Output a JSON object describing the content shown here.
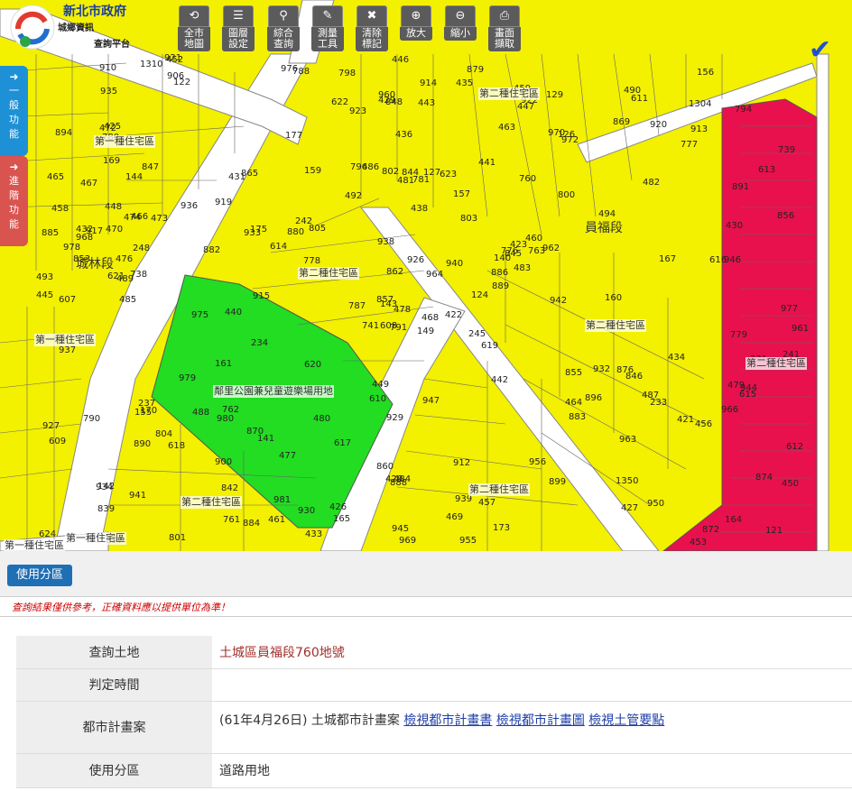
{
  "logo": {
    "line1": "新北市政府",
    "line2": "城鄉資訊",
    "line3": "查詢平台"
  },
  "toolbar": [
    {
      "icon": "refresh-icon",
      "glyph": "⟲",
      "label_l1": "全市",
      "label_l2": "地圖"
    },
    {
      "icon": "layers-icon",
      "glyph": "☰",
      "label_l1": "圖層",
      "label_l2": "設定"
    },
    {
      "icon": "search-icon",
      "glyph": "⚲",
      "label_l1": "綜合",
      "label_l2": "查詢"
    },
    {
      "icon": "ruler-icon",
      "glyph": "✎",
      "label_l1": "測量",
      "label_l2": "工具"
    },
    {
      "icon": "clear-icon",
      "glyph": "✖",
      "label_l1": "清除",
      "label_l2": "標記"
    },
    {
      "icon": "zoom-in-icon",
      "glyph": "⊕",
      "label_l1": "放大",
      "label_l2": ""
    },
    {
      "icon": "zoom-out-icon",
      "glyph": "⊖",
      "label_l1": "縮小",
      "label_l2": ""
    },
    {
      "icon": "print-icon",
      "glyph": "⎙",
      "label_l1": "畫面",
      "label_l2": "擷取"
    }
  ],
  "side_tabs": {
    "general": {
      "arrow": "➜",
      "label": "一般功能"
    },
    "advanced": {
      "arrow": "➜",
      "label": "進階功能"
    }
  },
  "map": {
    "colors": {
      "residential": "#f3f000",
      "road": "#ffffff",
      "park": "#22dd22",
      "red_zone": "#e8114d"
    },
    "zone_labels": [
      {
        "id": "z1",
        "text": "第一種住宅區"
      },
      {
        "id": "z2",
        "text": "第一種住宅區"
      },
      {
        "id": "z3",
        "text": "第二種住宅區"
      },
      {
        "id": "z4",
        "text": "第二種住宅區"
      },
      {
        "id": "z5",
        "text": "第二種住宅區"
      },
      {
        "id": "z6",
        "text": "第二種住宅區"
      },
      {
        "id": "z7",
        "text": "第二種住宅區"
      },
      {
        "id": "z8",
        "text": "鄰里公園兼兒童遊樂場用地"
      },
      {
        "id": "z9",
        "text": "第二種住宅區"
      },
      {
        "id": "z10",
        "text": "第一種住宅區"
      },
      {
        "id": "z11",
        "text": "第一種住宅區"
      }
    ],
    "section_labels": [
      {
        "id": "s1",
        "text": "員福段"
      },
      {
        "id": "s2",
        "text": "城林段"
      }
    ],
    "parcels": [
      "149",
      "144",
      "143",
      "142",
      "140",
      "141",
      "129",
      "127",
      "126",
      "124",
      "122",
      "121",
      "738",
      "739",
      "741",
      "800",
      "801",
      "802",
      "803",
      "804",
      "805",
      "839",
      "842",
      "844",
      "845",
      "846",
      "847",
      "848",
      "853",
      "855",
      "856",
      "857",
      "860",
      "862",
      "865",
      "869",
      "870",
      "872",
      "874",
      "876",
      "879",
      "880",
      "882",
      "883",
      "884",
      "885",
      "886",
      "887",
      "888",
      "889",
      "890",
      "891",
      "894",
      "896",
      "899",
      "900",
      "906",
      "910",
      "912",
      "913",
      "914",
      "915",
      "917",
      "919",
      "920",
      "921",
      "922",
      "923",
      "926",
      "927",
      "929",
      "930",
      "932",
      "933",
      "934",
      "935",
      "936",
      "937",
      "938",
      "939",
      "940",
      "941",
      "942",
      "944",
      "945",
      "946",
      "947",
      "950",
      "955",
      "956",
      "960",
      "961",
      "962",
      "963",
      "964",
      "966",
      "968",
      "969",
      "970",
      "972",
      "975",
      "976",
      "977",
      "978",
      "979",
      "980",
      "981",
      "776",
      "777",
      "778",
      "779",
      "780",
      "781",
      "787",
      "788",
      "790",
      "791",
      "794",
      "796",
      "798",
      "155",
      "156",
      "157",
      "159",
      "160",
      "161",
      "164",
      "165",
      "167",
      "169",
      "170",
      "173",
      "175",
      "177",
      "231",
      "233",
      "234",
      "237",
      "241",
      "242",
      "245",
      "248",
      "421",
      "422",
      "423",
      "425",
      "426",
      "427",
      "428",
      "429",
      "430",
      "431",
      "432",
      "433",
      "434",
      "435",
      "436",
      "438",
      "440",
      "441",
      "442",
      "443",
      "445",
      "446",
      "447",
      "448",
      "449",
      "450",
      "452",
      "453",
      "456",
      "457",
      "458",
      "459",
      "460",
      "461",
      "463",
      "464",
      "465",
      "466",
      "467",
      "468",
      "469",
      "470",
      "472",
      "473",
      "474",
      "476",
      "477",
      "478",
      "479",
      "480",
      "481",
      "482",
      "483",
      "484",
      "485",
      "486",
      "487",
      "488",
      "489",
      "490",
      "492",
      "493",
      "494",
      "607",
      "608",
      "609",
      "610",
      "611",
      "612",
      "613",
      "614",
      "615",
      "616",
      "617",
      "618",
      "619",
      "620",
      "621",
      "622",
      "623",
      "624",
      "760",
      "761",
      "762",
      "763",
      "1304",
      "1310",
      "1350"
    ]
  },
  "panel": {
    "zone_button": "使用分區",
    "disclaimer": "查詢結果僅供參考，正確資料應以提供單位為準！",
    "rows": [
      {
        "key": "查詢土地",
        "value": "土城區員福段760地號"
      },
      {
        "key": "判定時間",
        "value": ""
      },
      {
        "key": "都市計畫案",
        "value": "(61年4月26日) 土城都市計畫案",
        "links": [
          "檢視都市計畫書",
          "檢視都市計畫圖",
          "檢視土管要點"
        ]
      },
      {
        "key": "使用分區",
        "value": "道路用地"
      }
    ]
  }
}
